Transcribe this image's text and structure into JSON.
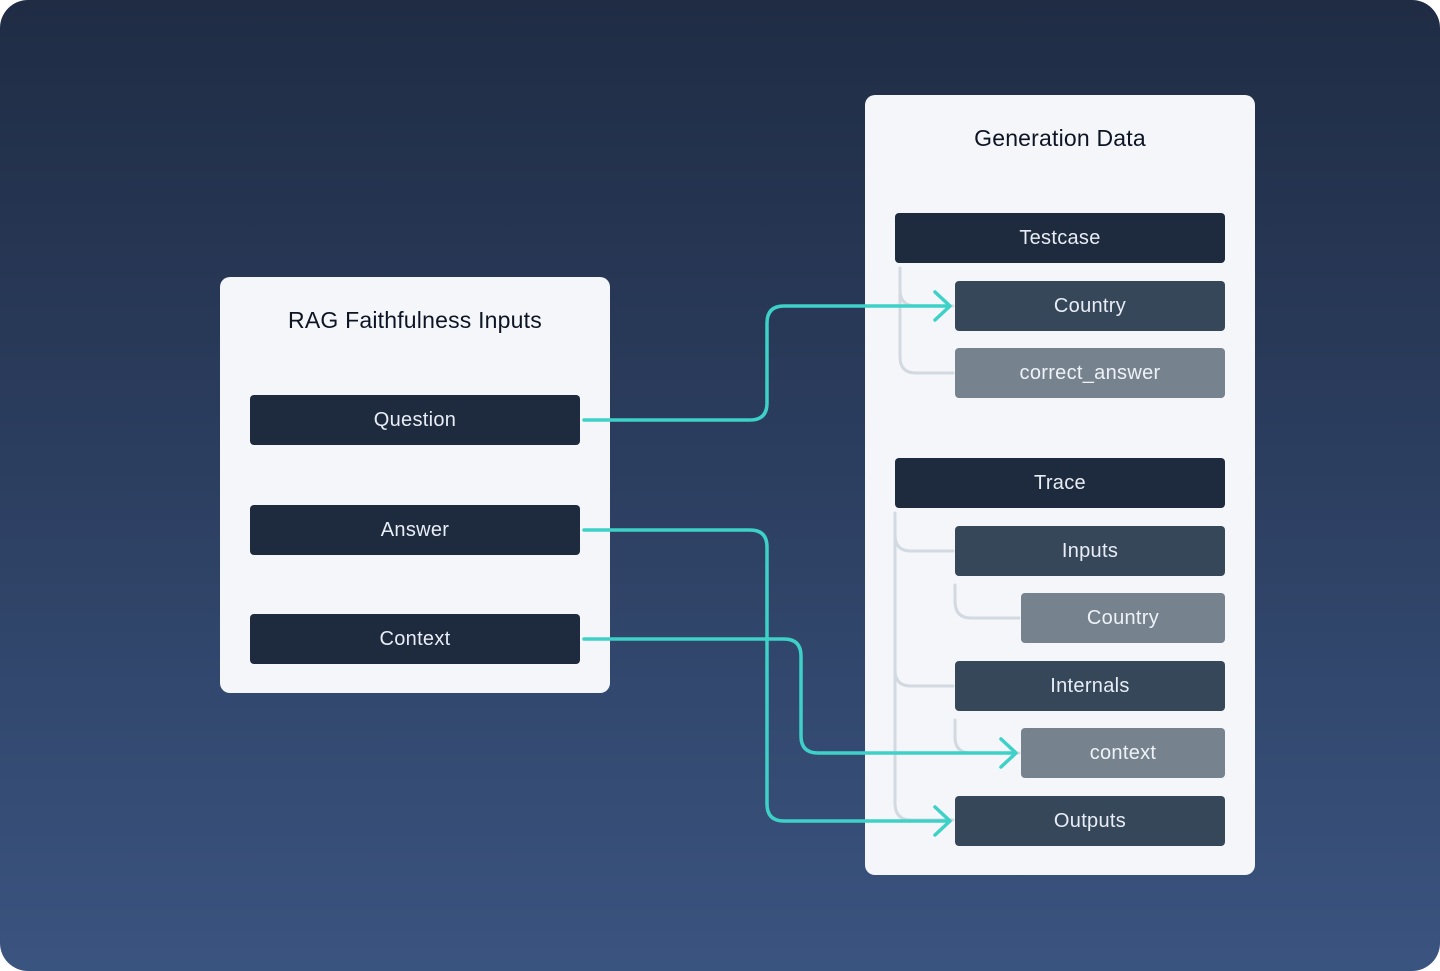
{
  "left_panel": {
    "title": "RAG Faithfulness Inputs",
    "items": [
      {
        "key": "question",
        "label": "Question"
      },
      {
        "key": "answer",
        "label": "Answer"
      },
      {
        "key": "context",
        "label": "Context"
      }
    ]
  },
  "right_panel": {
    "title": "Generation Data",
    "testcase": {
      "label": "Testcase",
      "children": [
        {
          "key": "testcase-country",
          "label": "Country"
        },
        {
          "key": "correct-answer",
          "label": "correct_answer"
        }
      ]
    },
    "trace": {
      "label": "Trace",
      "inputs": {
        "label": "Inputs",
        "country": "Country"
      },
      "internals": {
        "label": "Internals",
        "context": "context"
      },
      "outputs": {
        "label": "Outputs"
      }
    }
  },
  "connections": [
    {
      "from": "Question",
      "to": "Country"
    },
    {
      "from": "Answer",
      "to": "Outputs"
    },
    {
      "from": "Context",
      "to": "context"
    }
  ],
  "colors": {
    "background_top": "#1f2c44",
    "background_bottom": "#3a5480",
    "panel": "#f4f6fa",
    "box_dark": "#1e2a3d",
    "box_mid": "#37475a",
    "box_light": "#76838f",
    "connector": "#3ed1c8",
    "tree_line": "#d3d9e1"
  }
}
